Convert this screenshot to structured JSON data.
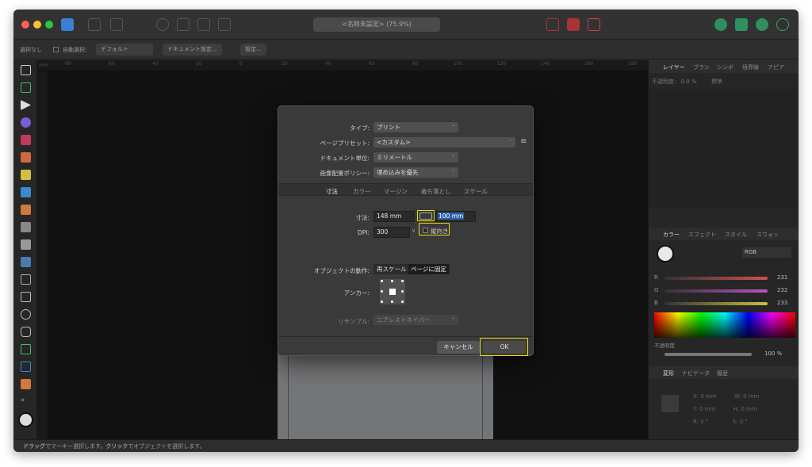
{
  "window": {
    "title": "<名称未設定> (75.9%)"
  },
  "context_bar": {
    "selection": "選択なし",
    "auto_select_label": "自動選択:",
    "auto_select_value": "デフォルト",
    "document_setup": "ドキュメント設定...",
    "preferences": "設定..."
  },
  "ruler": {
    "unit": "mm",
    "ticks": [
      "-80",
      "-60",
      "-40",
      "-20",
      "0",
      "20",
      "40",
      "60",
      "80",
      "100",
      "120",
      "140",
      "160",
      "180"
    ]
  },
  "right_panel": {
    "top_tabs": [
      "レイヤー",
      "ブラシ",
      "シンボ",
      "境界線",
      "アピア"
    ],
    "opacity_label": "不透明度:",
    "opacity_value": "0.0 %",
    "blend_mode": "標準",
    "color_tabs": [
      "カラー",
      "エフェクト",
      "スタイル",
      "スウォッ"
    ],
    "color_mode": "RGB",
    "channels": [
      {
        "label": "R",
        "value": "231",
        "color": "#e06060"
      },
      {
        "label": "G",
        "value": "232",
        "color": "#c060c0"
      },
      {
        "label": "B",
        "value": "233",
        "color": "#d0d040"
      }
    ],
    "opacity2_label": "不透明度",
    "opacity2_value": "100 %",
    "transform_tabs": [
      "変形",
      "ナビゲータ",
      "履歴"
    ],
    "transform_fields": {
      "x_label": "X:",
      "x_value": "0 mm",
      "y_label": "Y:",
      "y_value": "0 mm",
      "w_label": "W:",
      "w_value": "0 mm",
      "h_label": "H:",
      "h_value": "0 mm",
      "r_label": "R:",
      "r_value": "0 °",
      "s_label": "S:",
      "s_value": "0 °"
    }
  },
  "status_bar": {
    "drag": "ドラッグ",
    "drag_desc": "でマーキー選択します。",
    "click": "クリック",
    "click_desc": "でオブジェクトを選択します。"
  },
  "dialog": {
    "type_label": "タイプ:",
    "type_value": "プリント",
    "preset_label": "ページプリセット:",
    "preset_value": "<カスタム>",
    "units_label": "ドキュメント単位:",
    "units_value": "ミリメートル",
    "placement_label": "画像配置ポリシー:",
    "placement_value": "埋め込みを優先",
    "tabs": [
      "寸法",
      "カラー",
      "マージン",
      "裁ち落とし",
      "スケール"
    ],
    "size_label": "寸法:",
    "width_value": "148 mm",
    "height_value": "100 mm",
    "dpi_label": "DPI:",
    "dpi_value": "300",
    "portrait_label": "縦向き",
    "object_behavior_label": "オブジェクトの動作:",
    "rescale_option": "再スケール",
    "anchor_option": "ページに固定",
    "anchor_label": "アンカー:",
    "resample_label": "リサンプル:",
    "resample_value": "ニアレストネイバー",
    "cancel": "キャンセル",
    "ok": "OK",
    "highlight_color": "#e8e000"
  }
}
